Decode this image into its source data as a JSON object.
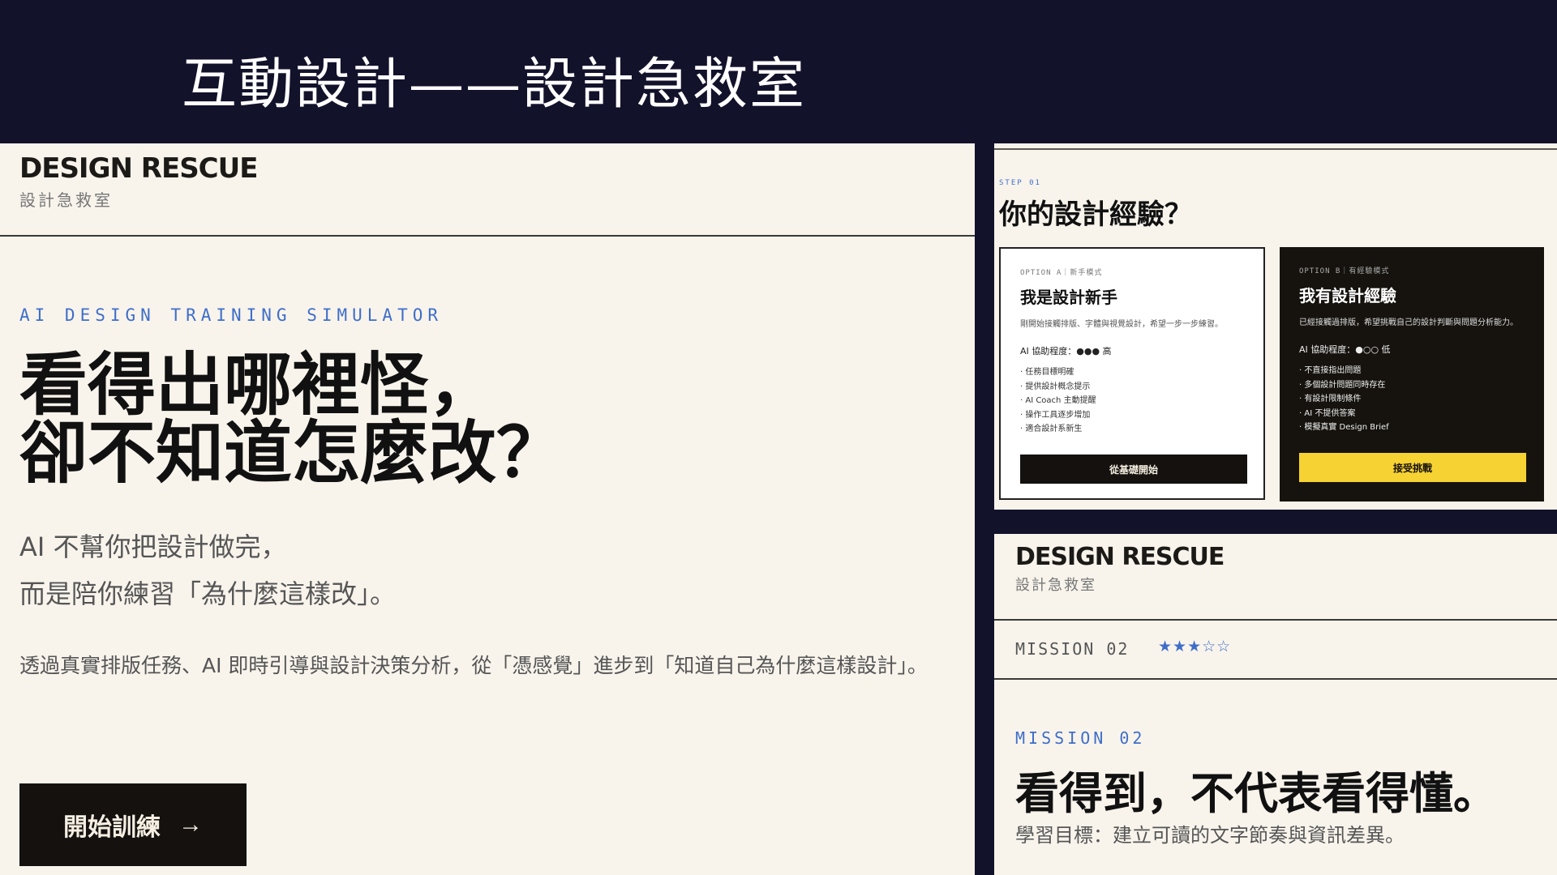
{
  "slide": {
    "title": "互動設計——設計急救室"
  },
  "left": {
    "brand": {
      "name": "DESIGN RESCUE",
      "subtitle": "設計急救室"
    },
    "eyebrow": "AI DESIGN TRAINING SIMULATOR",
    "headline": {
      "line1": "看得出哪裡怪，",
      "line2": "卻不知道怎麼改？"
    },
    "sub": {
      "line1": "AI 不幫你把設計做完，",
      "line2": "而是陪你練習「為什麼這樣改」。"
    },
    "body": "透過真實排版任務、AI 即時引導與設計決策分析，從「憑感覺」進步到「知道自己為什麼這樣設計」。",
    "cta": {
      "label": "開始訓練",
      "arrow": "→"
    }
  },
  "right_top": {
    "step": "STEP 01",
    "question": "你的設計經驗？",
    "options": [
      {
        "tag": "OPTION A｜新手模式",
        "title": "我是設計新手",
        "desc": "剛開始接觸排版、字體與視覺設計，希望一步一步練習。",
        "assist": "AI 協助程度：●●● 高",
        "points": [
          "· 任務目標明確",
          "· 提供設計概念提示",
          "· AI Coach 主動提醒",
          "· 操作工具逐步增加",
          "· 適合設計系新生"
        ],
        "button": "從基礎開始"
      },
      {
        "tag": "OPTION B｜有經驗模式",
        "title": "我有設計經驗",
        "desc": "已經接觸過排版，希望挑戰自己的設計判斷與問題分析能力。",
        "assist": "AI 協助程度：●○○ 低",
        "points": [
          "· 不直接指出問題",
          "· 多個設計問題同時存在",
          "· 有設計限制條件",
          "· AI 不提供答案",
          "· 模擬真實 Design Brief"
        ],
        "button": "接受挑戰"
      }
    ]
  },
  "right_bottom": {
    "brand": {
      "name": "DESIGN RESCUE",
      "subtitle": "設計急救室"
    },
    "mission_code": "MISSION 02",
    "rating": "★★★☆☆",
    "eyebrow": "MISSION 02",
    "heading": "看得到，不代表看得懂。",
    "goal": "學習目標：建立可讀的文字節奏與資訊差異。"
  },
  "colors": {
    "dark_bg": "#13122b",
    "paper": "#f8f4ec",
    "accent_blue": "#3f6ec9",
    "accent_yellow": "#f7d233",
    "ink": "#15110e"
  }
}
